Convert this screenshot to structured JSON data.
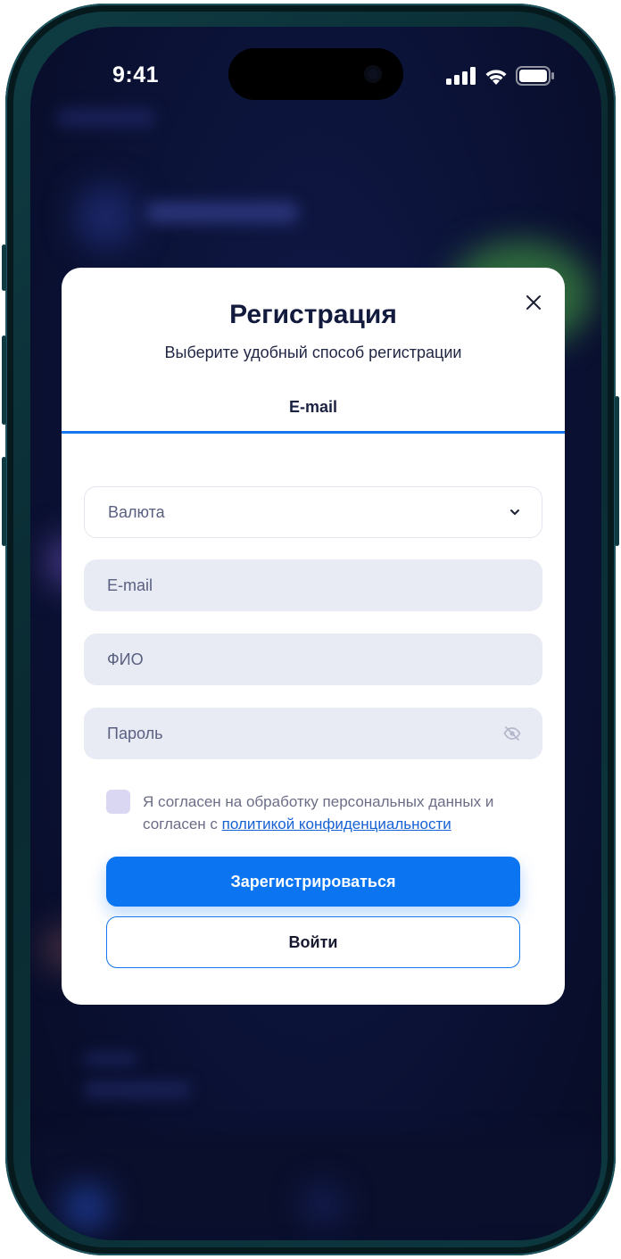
{
  "status_bar": {
    "time": "9:41",
    "icons": [
      "cellular-signal-icon",
      "wifi-icon",
      "battery-icon"
    ]
  },
  "modal": {
    "title": "Регистрация",
    "subtitle": "Выберите удобный способ регистрации",
    "tab_label": "E-mail",
    "close_icon": "close-icon"
  },
  "form": {
    "currency": {
      "value": "Валюта",
      "icon": "chevron-down-icon"
    },
    "email": {
      "placeholder": "E-mail"
    },
    "full_name": {
      "placeholder": "ФИО"
    },
    "password": {
      "placeholder": "Пароль",
      "icon": "eye-off-icon"
    },
    "consent": {
      "checked": false,
      "text_before": "Я согласен на обработку персональных данных и согласен с ",
      "link_text": "политикой конфиденциальности"
    },
    "register_label": "Зарегистрироваться",
    "login_label": "Войти"
  },
  "colors": {
    "accent": "#0a74f1",
    "link": "#1661d4",
    "field_bg": "#e8eaf4",
    "checkbox_bg": "#dad7f3",
    "backdrop": "#0b1236"
  }
}
